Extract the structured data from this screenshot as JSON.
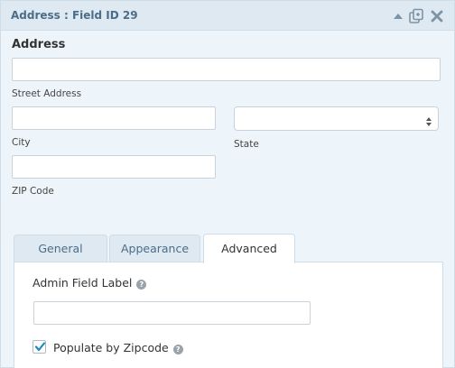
{
  "header": {
    "title": "Address : Field ID 29",
    "icons": [
      "collapse-icon",
      "duplicate-icon",
      "delete-icon"
    ]
  },
  "field": {
    "label": "Address",
    "street_address": {
      "value": "",
      "sublabel": "Street Address"
    },
    "city": {
      "value": "",
      "sublabel": "City"
    },
    "state": {
      "selected": "",
      "sublabel": "State"
    },
    "zip": {
      "value": "",
      "sublabel": "ZIP Code"
    }
  },
  "tabs": [
    {
      "label": "General",
      "active": false
    },
    {
      "label": "Appearance",
      "active": false
    },
    {
      "label": "Advanced",
      "active": true
    }
  ],
  "advanced": {
    "admin_field_label": {
      "label": "Admin Field Label",
      "value": ""
    },
    "populate_by_zipcode": {
      "label": "Populate by Zipcode",
      "checked": true
    }
  },
  "colors": {
    "header_bg": "#dfe9f1",
    "panel_bg": "#eef5fa",
    "accent": "#4b6d8a",
    "checkbox_check": "#1e8cbe"
  }
}
